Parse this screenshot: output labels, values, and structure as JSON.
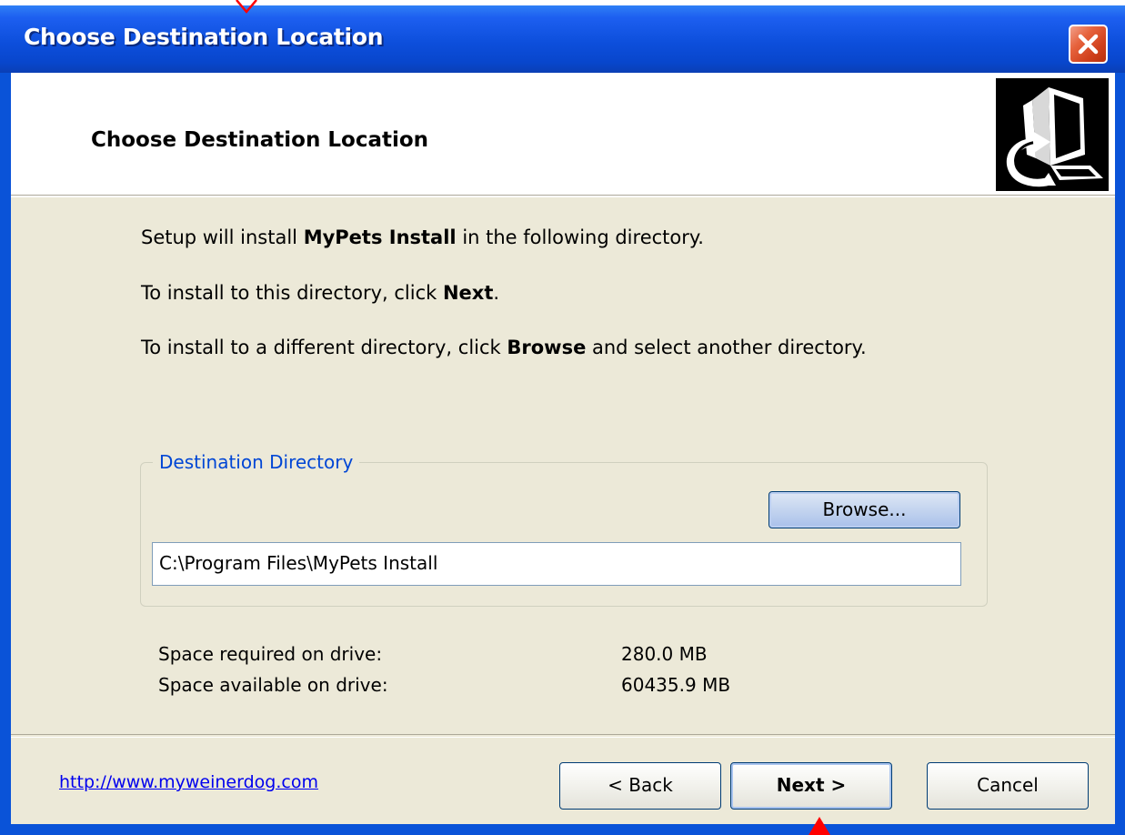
{
  "window": {
    "title": "Choose Destination Location"
  },
  "header": {
    "title": "Choose Destination Location"
  },
  "messages": {
    "line1_pre": "Setup will install ",
    "line1_bold": "MyPets Install",
    "line1_post": " in the following directory.",
    "line2_pre": "To install to this directory, click ",
    "line2_bold": "Next",
    "line2_post": ".",
    "line3_pre": "To install to a different directory, click ",
    "line3_bold": "Browse",
    "line3_post": " and select another directory."
  },
  "destination": {
    "group_label": "Destination Directory",
    "browse_label": "Browse...",
    "path": "C:\\Program Files\\MyPets Install"
  },
  "space": {
    "required_label": "Space required on drive:",
    "required_value": "280.0 MB",
    "available_label": "Space available on drive:",
    "available_value": "60435.9 MB"
  },
  "footer": {
    "link": "http://www.myweinerdog.com",
    "back_label": "< Back",
    "next_label": "Next >",
    "cancel_label": "Cancel"
  },
  "colors": {
    "titlebar": "#0a53d8",
    "dialog_bg": "#ece9d8",
    "group_label": "#0046d5",
    "cursor_marker": "#ff0000"
  },
  "icons": [
    "close-icon",
    "computer-install-icon"
  ]
}
